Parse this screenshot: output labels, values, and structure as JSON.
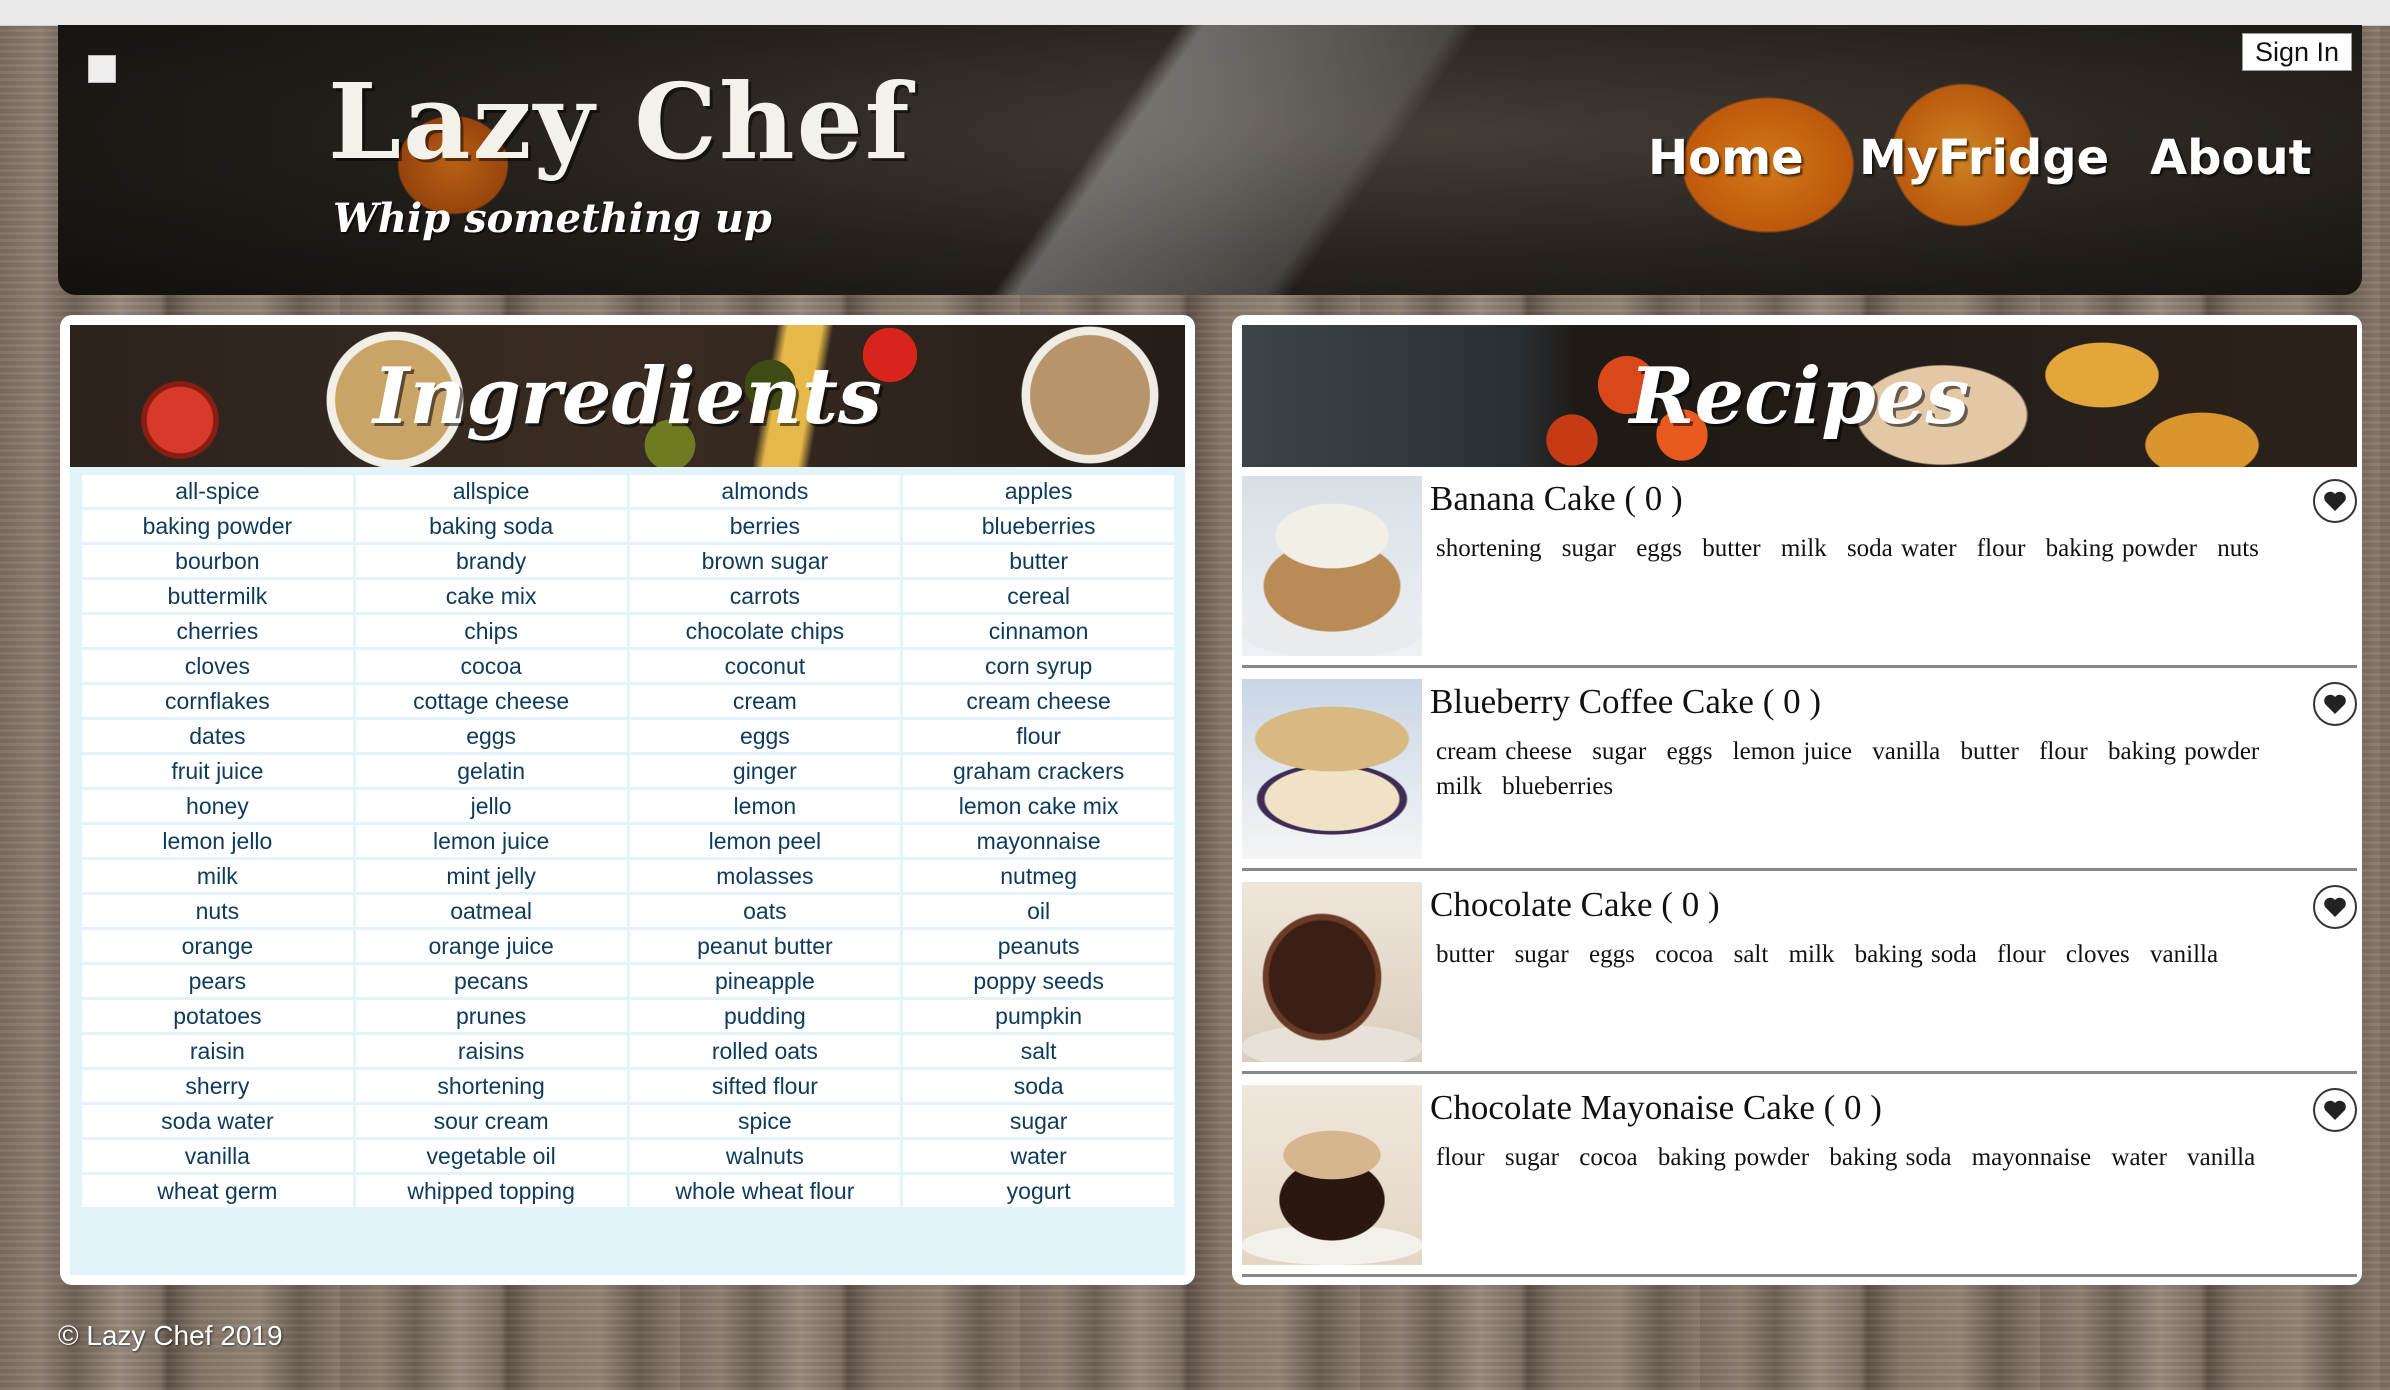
{
  "header": {
    "title": "Lazy Chef",
    "tagline": "Whip something up",
    "nav": [
      {
        "label": "Home"
      },
      {
        "label": "MyFridge"
      },
      {
        "label": "About"
      }
    ],
    "signin_label": "Sign In"
  },
  "ingredients_panel": {
    "title": "Ingredients",
    "items": [
      "all-spice",
      "allspice",
      "almonds",
      "apples",
      "baking powder",
      "baking soda",
      "berries",
      "blueberries",
      "bourbon",
      "brandy",
      "brown sugar",
      "butter",
      "buttermilk",
      "cake mix",
      "carrots",
      "cereal",
      "cherries",
      "chips",
      "chocolate chips",
      "cinnamon",
      "cloves",
      "cocoa",
      "coconut",
      "corn syrup",
      "cornflakes",
      "cottage cheese",
      "cream",
      "cream cheese",
      "dates",
      "eggs",
      "eggs",
      "flour",
      "fruit juice",
      "gelatin",
      "ginger",
      "graham crackers",
      "honey",
      "jello",
      "lemon",
      "lemon cake mix",
      "lemon jello",
      "lemon juice",
      "lemon peel",
      "mayonnaise",
      "milk",
      "mint jelly",
      "molasses",
      "nutmeg",
      "nuts",
      "oatmeal",
      "oats",
      "oil",
      "orange",
      "orange juice",
      "peanut butter",
      "peanuts",
      "pears",
      "pecans",
      "pineapple",
      "poppy seeds",
      "potatoes",
      "prunes",
      "pudding",
      "pumpkin",
      "raisin",
      "raisins",
      "rolled oats",
      "salt",
      "sherry",
      "shortening",
      "sifted flour",
      "soda",
      "soda water",
      "sour cream",
      "spice",
      "sugar",
      "vanilla",
      "vegetable oil",
      "walnuts",
      "water",
      "wheat germ",
      "whipped topping",
      "whole wheat flour",
      "yogurt"
    ]
  },
  "recipes_panel": {
    "title": "Recipes",
    "recipes": [
      {
        "name": "Banana Cake ( 0 )",
        "ingredients": [
          "shortening",
          "sugar",
          "eggs",
          "butter",
          "milk",
          "soda water",
          "flour",
          "baking powder",
          "nuts"
        ]
      },
      {
        "name": "Blueberry Coffee Cake ( 0 )",
        "ingredients": [
          "cream cheese",
          "sugar",
          "eggs",
          "lemon juice",
          "vanilla",
          "butter",
          "flour",
          "baking powder",
          "milk",
          "blueberries"
        ]
      },
      {
        "name": "Chocolate Cake ( 0 )",
        "ingredients": [
          "butter",
          "sugar",
          "eggs",
          "cocoa",
          "salt",
          "milk",
          "baking soda",
          "flour",
          "cloves",
          "vanilla"
        ]
      },
      {
        "name": "Chocolate Mayonaise Cake ( 0 )",
        "ingredients": [
          "flour",
          "sugar",
          "cocoa",
          "baking powder",
          "baking soda",
          "mayonnaise",
          "water",
          "vanilla"
        ]
      }
    ]
  },
  "footer": {
    "text": "© Lazy Chef 2019"
  },
  "icons": {
    "favorite": "heart-icon",
    "logo": "broken-image-icon"
  }
}
